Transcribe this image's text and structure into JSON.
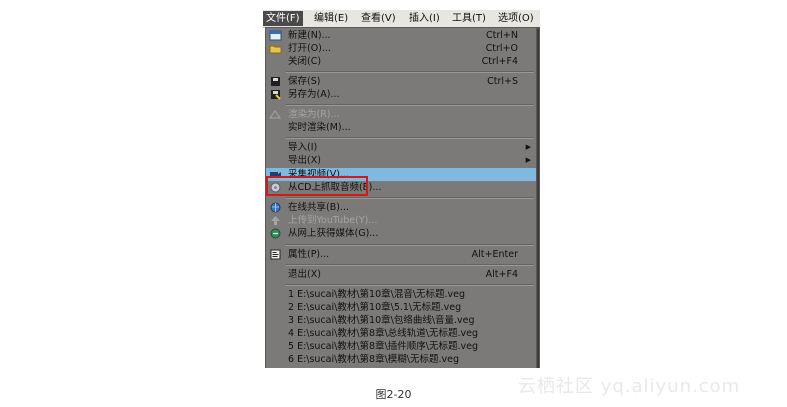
{
  "menubar": {
    "items": [
      "文件(F)",
      "编辑(E)",
      "查看(V)",
      "插入(I)",
      "工具(T)",
      "选项(O)"
    ]
  },
  "file_menu": {
    "items": [
      {
        "label": "新建(N)...",
        "shortcut": "Ctrl+N",
        "icon": "new-document-icon"
      },
      {
        "label": "打开(O)...",
        "shortcut": "Ctrl+O",
        "icon": "open-folder-icon"
      },
      {
        "label": "关闭(C)",
        "shortcut": "Ctrl+F4"
      },
      {
        "label": "保存(S)",
        "shortcut": "Ctrl+S",
        "icon": "save-icon"
      },
      {
        "label": "另存为(A)...",
        "icon": "save-as-icon"
      },
      {
        "label": "渲染为(R)...",
        "icon": "render-icon",
        "disabled": true
      },
      {
        "label": "实时渲染(M)..."
      },
      {
        "label": "导入(I)",
        "submenu": true
      },
      {
        "label": "导出(X)",
        "submenu": true
      },
      {
        "label": "采集视频(V)...",
        "icon": "capture-video-icon",
        "highlighted": true
      },
      {
        "label": "从CD上抓取音频(E)...",
        "icon": "cd-audio-icon"
      },
      {
        "label": "在线共享(B)...",
        "icon": "share-online-icon"
      },
      {
        "label": "上传到YouTube(Y)...",
        "icon": "youtube-upload-icon",
        "disabled": true
      },
      {
        "label": "从网上获得媒体(G)...",
        "icon": "web-media-icon"
      },
      {
        "label": "属性(P)...",
        "shortcut": "Alt+Enter",
        "icon": "properties-icon"
      },
      {
        "label": "退出(X)",
        "shortcut": "Alt+F4"
      },
      {
        "label": "1 E:\\sucai\\教材\\第10章\\混音\\无标题.veg"
      },
      {
        "label": "2 E:\\sucai\\教材\\第10章\\5.1\\无标题.veg"
      },
      {
        "label": "3 E:\\sucai\\教材\\第10章\\包络曲线\\音量.veg"
      },
      {
        "label": "4 E:\\sucai\\教材\\第8章\\总线轨道\\无标题.veg"
      },
      {
        "label": "5 E:\\sucai\\教材\\第8章\\插件顺序\\无标题.veg"
      },
      {
        "label": "6 E:\\sucai\\教材\\第8章\\模糊\\无标题.veg"
      }
    ]
  },
  "caption": "图2-20",
  "watermark": "云栖社区 yq.aliyun.com",
  "colors": {
    "menu_bg": "#7c7a78",
    "highlight": "#7fb9df",
    "annotation_box": "#d21a1a"
  }
}
